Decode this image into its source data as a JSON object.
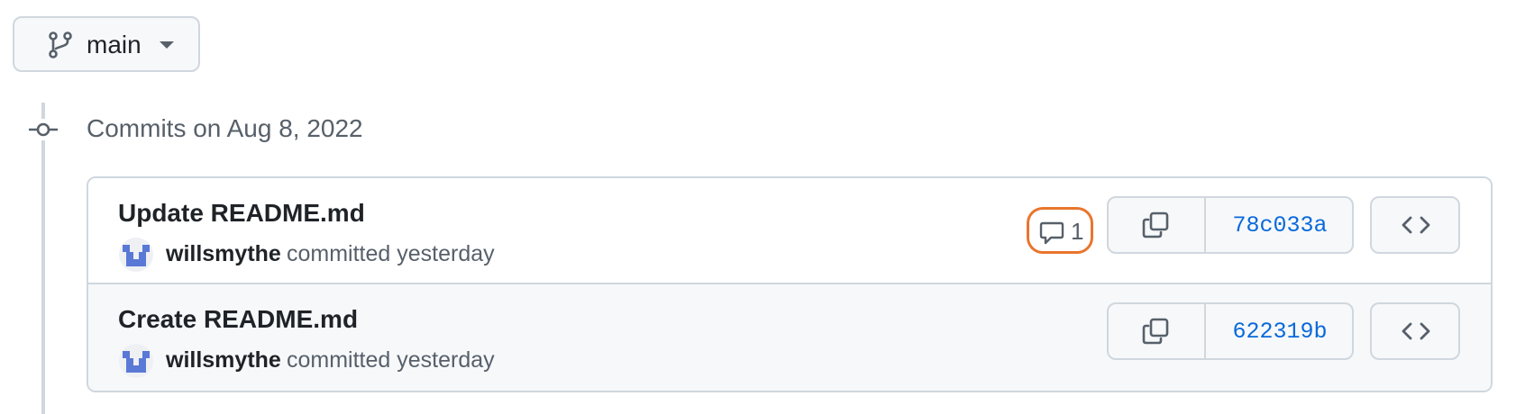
{
  "branch": {
    "name": "main",
    "icon": "git-branch-icon"
  },
  "commit_group": {
    "heading": "Commits on Aug 8, 2022",
    "icon": "git-commit-icon"
  },
  "commits": [
    {
      "title": "Update README.md",
      "author": "willsmythe",
      "meta": "committed yesterday",
      "comments": "1",
      "sha": "78c033a"
    },
    {
      "title": "Create README.md",
      "author": "willsmythe",
      "meta": "committed yesterday",
      "sha": "622319b"
    }
  ],
  "colors": {
    "link": "#0969da",
    "border": "#d0d7de",
    "muted_text": "#57606a",
    "highlight": "#e8762d",
    "avatar_blue": "#5a78d6"
  }
}
